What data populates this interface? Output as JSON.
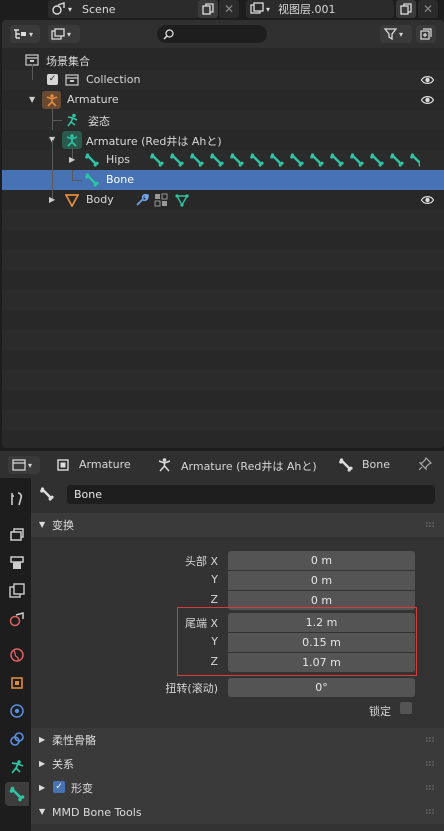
{
  "topbar": {
    "scene_label": "Scene",
    "viewlayer_label": "视图层.001"
  },
  "outliner": {
    "search_placeholder": "",
    "rows": [
      {
        "label": "场景集合"
      },
      {
        "label": "Collection"
      },
      {
        "label": "Armature"
      },
      {
        "label": "姿态"
      },
      {
        "label": "Armature (Red井は Ahと)"
      },
      {
        "label": "Hips"
      },
      {
        "label": "Bone"
      },
      {
        "label": "Body"
      }
    ]
  },
  "properties": {
    "breadcrumb": {
      "object": "Armature",
      "armature": "Armature (Red井は Ahと)",
      "bone": "Bone"
    },
    "bone_name": "Bone",
    "panels": {
      "transform": "变换",
      "deform_bones": "柔性骨骼",
      "relations": "关系",
      "deform": "形变",
      "mmd_tools": "MMD Bone Tools"
    },
    "head": {
      "label_x": "头部 X",
      "label_y": "Y",
      "label_z": "Z",
      "x": "0 m",
      "y": "0 m",
      "z": "0 m"
    },
    "tail": {
      "label_x": "尾端 X",
      "label_y": "Y",
      "label_z": "Z",
      "x": "1.2 m",
      "y": "0.15 m",
      "z": "1.07 m"
    },
    "roll": {
      "label": "扭转(滚动)",
      "value": "0°"
    },
    "lock": {
      "label": "锁定",
      "checked": false
    },
    "deform_checked": true
  },
  "colors": {
    "selection": "#4772b3",
    "bone_teal": "#2ec4a4",
    "armature_orange": "#e08a3c",
    "highlight_box": "#d93a3a"
  }
}
